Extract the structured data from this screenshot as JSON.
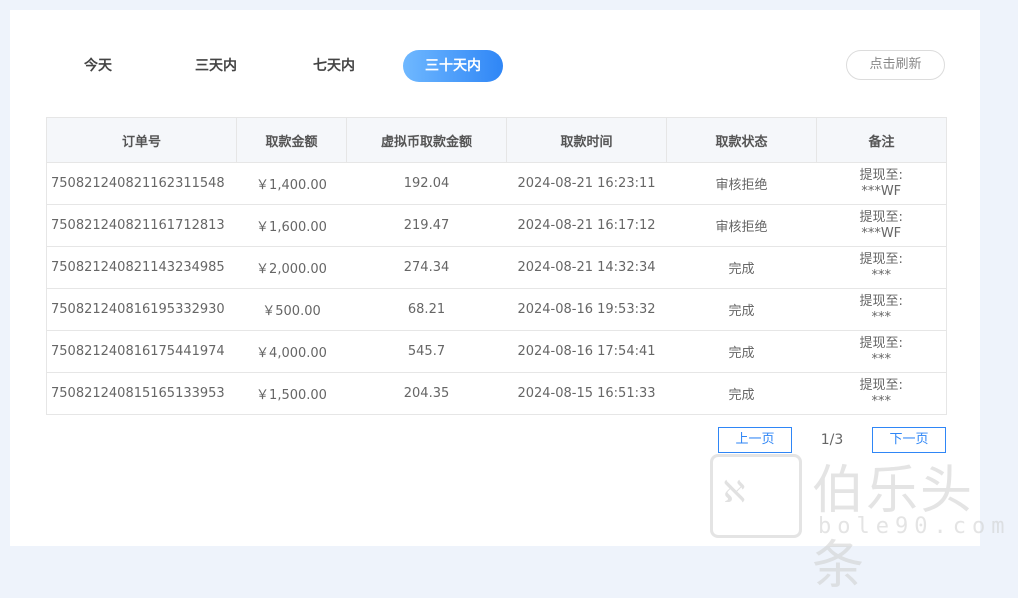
{
  "filters": {
    "tabs": [
      {
        "label": "今天",
        "active": false
      },
      {
        "label": "三天内",
        "active": false
      },
      {
        "label": "七天内",
        "active": false
      },
      {
        "label": "三十天内",
        "active": true
      }
    ],
    "refresh_label": "点击刷新"
  },
  "table": {
    "headers": [
      "订单号",
      "取款金额",
      "虚拟币取款金额",
      "取款时间",
      "取款状态",
      "备注"
    ],
    "rows": [
      {
        "order_no": "750821240821162311548",
        "amount": "￥1,400.00",
        "crypto_amount": "192.04",
        "time": "2024-08-21 16:23:11",
        "status": "审核拒绝",
        "status_type": "rejected",
        "note_line1": "提现至:",
        "note_line2": "***WF"
      },
      {
        "order_no": "750821240821161712813",
        "amount": "￥1,600.00",
        "crypto_amount": "219.47",
        "time": "2024-08-21 16:17:12",
        "status": "审核拒绝",
        "status_type": "rejected",
        "note_line1": "提现至:",
        "note_line2": "***WF"
      },
      {
        "order_no": "750821240821143234985",
        "amount": "￥2,000.00",
        "crypto_amount": "274.34",
        "time": "2024-08-21 14:32:34",
        "status": "完成",
        "status_type": "done",
        "note_line1": "提现至:",
        "note_line2": "***"
      },
      {
        "order_no": "750821240816195332930",
        "amount": "￥500.00",
        "crypto_amount": "68.21",
        "time": "2024-08-16 19:53:32",
        "status": "完成",
        "status_type": "done",
        "note_line1": "提现至:",
        "note_line2": "***"
      },
      {
        "order_no": "750821240816175441974",
        "amount": "￥4,000.00",
        "crypto_amount": "545.7",
        "time": "2024-08-16 17:54:41",
        "status": "完成",
        "status_type": "done",
        "note_line1": "提现至:",
        "note_line2": "***"
      },
      {
        "order_no": "750821240815165133953",
        "amount": "￥1,500.00",
        "crypto_amount": "204.35",
        "time": "2024-08-15 16:51:33",
        "status": "完成",
        "status_type": "done",
        "note_line1": "提现至:",
        "note_line2": "***"
      }
    ]
  },
  "pagination": {
    "prev_label": "上一页",
    "page_info": "1/3",
    "next_label": "下一页"
  },
  "watermark": {
    "title": "伯乐头条",
    "domain": "bole90.com"
  },
  "colors": {
    "accent": "#2f86f6",
    "rejected": "#e03a3a",
    "done": "#1f8a3b"
  }
}
